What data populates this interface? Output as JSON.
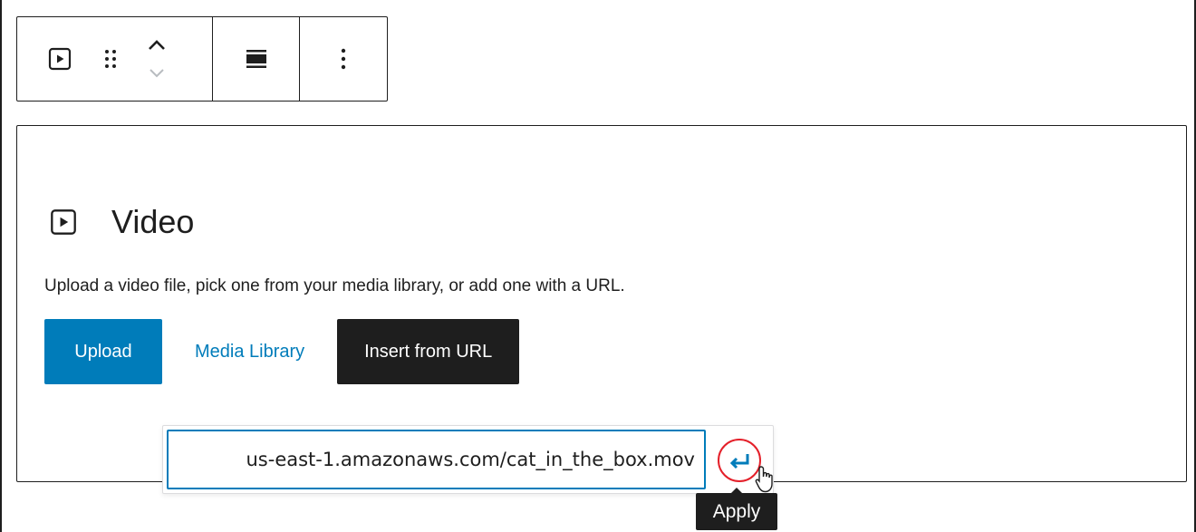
{
  "toolbar": {
    "block_type_icon": "video-icon",
    "drag_icon": "drag-handle-icon",
    "move_up_icon": "chevron-up-icon",
    "move_down_icon": "chevron-down-icon",
    "align_icon": "align-none-icon",
    "more_icon": "more-vertical-icon"
  },
  "placeholder": {
    "icon": "video-icon",
    "title": "Video",
    "instructions": "Upload a video file, pick one from your media library, or add one with a URL.",
    "upload_label": "Upload",
    "media_library_label": "Media Library",
    "insert_url_label": "Insert from URL"
  },
  "url_popover": {
    "url_value": "us-east-1.amazonaws.com/cat_in_the_box.mov",
    "apply_icon": "enter-return-icon",
    "apply_tooltip": "Apply"
  },
  "colors": {
    "accent": "#007cba",
    "dark": "#1e1e1e",
    "highlight_ring": "#e4202a"
  }
}
